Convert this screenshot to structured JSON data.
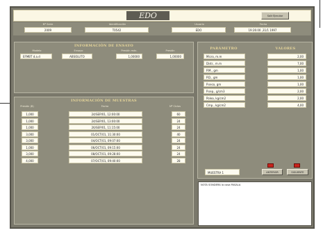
{
  "header": {
    "title": "EDO",
    "top_button": "Salir  Ejecutar"
  },
  "id_fields": [
    {
      "label": "Nº Serie",
      "value": "2009"
    },
    {
      "label": "Identificación",
      "value": "T0542"
    },
    {
      "label": "Usuario",
      "value": "EDO"
    },
    {
      "label": "Fecha",
      "value": "19:26:00  ,31/1 1997"
    }
  ],
  "tests_panel": {
    "title": "INFORMACIÓN DE ENSAYO",
    "fields": [
      {
        "label": "Modelo",
        "value": "EFMBT  d.a.d"
      },
      {
        "label": "Ensayo",
        "value": "ABSOLUTO"
      },
      {
        "label": "Presión máx.",
        "value": "1,00000"
      },
      {
        "label": "Presión",
        "value": "1,00000"
      }
    ]
  },
  "samples_panel": {
    "title": "INFORMACIÓN DE MUESTRAS",
    "col_a": "Presión (B)",
    "col_b": "Fecha",
    "col_c": "Nº Ciclos",
    "rows": [
      {
        "p": "1,000",
        "date": "24/SEP/01, 12:00:00",
        "n": "60"
      },
      {
        "p": "1,000",
        "date": "24/SEP/01, 13:00:00",
        "n": "24"
      },
      {
        "p": "1,000",
        "date": "26/SEP/01, 11:15:00",
        "n": "24"
      },
      {
        "p": "3,000",
        "date": "01/OCT/01, 11:30:00",
        "n": "40"
      },
      {
        "p": "3,000",
        "date": "04/OCT/01, 09:07:00",
        "n": "24"
      },
      {
        "p": "1,000",
        "date": "06/OCT/01, 09:15:00",
        "n": "24"
      },
      {
        "p": "3,000",
        "date": "08/OCT/01, 09:28:00",
        "n": "24"
      },
      {
        "p": "4,000",
        "date": "07/OCT/01, 09:40:00",
        "n": "28"
      }
    ]
  },
  "params_panel": {
    "col_param": "PARÁMETRO",
    "col_value": "VALORES",
    "rows": [
      {
        "name": "Micro, m.m",
        "value": "2,00"
      },
      {
        "name": "Distr., m.m",
        "value": "7,00"
      },
      {
        "name": "P.M.,  gm",
        "value": "1,00"
      },
      {
        "name": "P.D.,  gm",
        "value": "1,00"
      },
      {
        "name": "P.seco, gm",
        "value": "1,00"
      },
      {
        "name": "P.sep., g/cm3",
        "value": "2,00"
      },
      {
        "name": "Polea, kg/cm2",
        "value": "2,00"
      },
      {
        "name": "Cmp.,  kg/cm2",
        "value": "4,00"
      }
    ],
    "sample_field": "MUESTRA  1",
    "prev_button": "ANTERIOR",
    "next_button": "SIGUIENTE"
  },
  "notes": {
    "text": "NOTA SONDERA la cosa PASALA"
  },
  "colors": {
    "window": "#7a786b",
    "panel": "#8e8c7c",
    "title_gold": "#e8d79a",
    "box": "#fdfbf0",
    "red_mark": "#c8241c"
  }
}
